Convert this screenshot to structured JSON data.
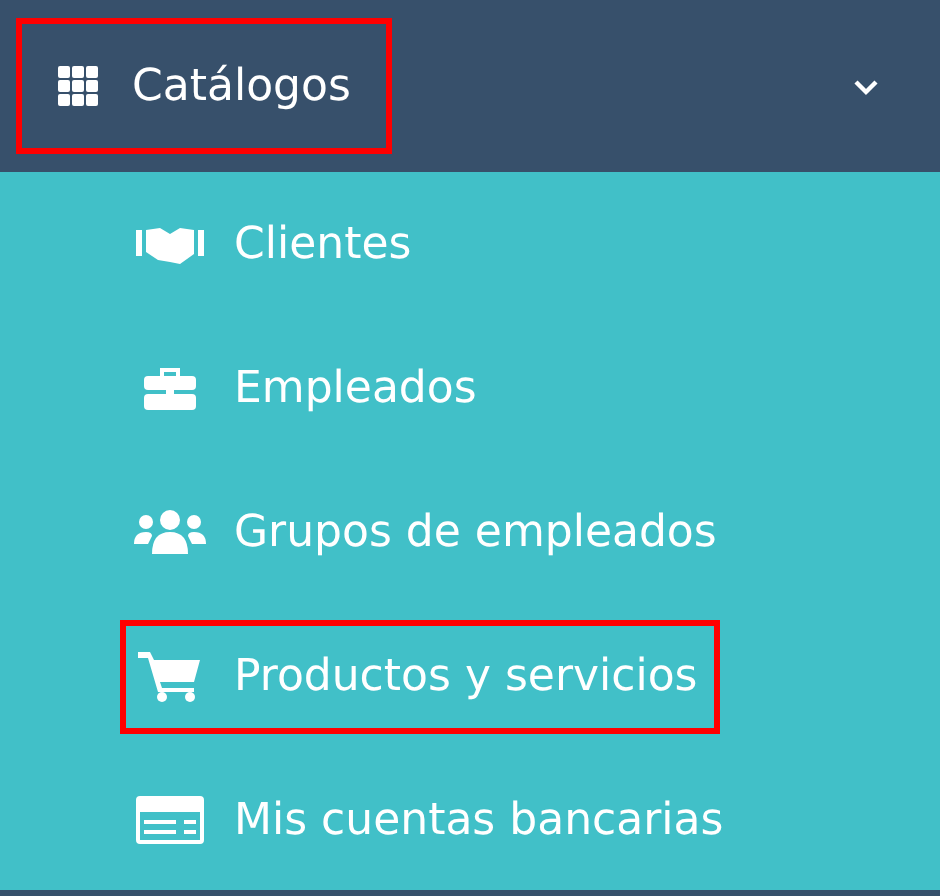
{
  "menu_header": {
    "label": "Catálogos",
    "expanded": true,
    "highlighted": true
  },
  "items": [
    {
      "label": "Clientes",
      "highlighted": false
    },
    {
      "label": "Empleados",
      "highlighted": false
    },
    {
      "label": "Grupos de empleados",
      "highlighted": false
    },
    {
      "label": "Productos y servicios",
      "highlighted": true
    },
    {
      "label": "Mis cuentas bancarias",
      "highlighted": false
    }
  ]
}
